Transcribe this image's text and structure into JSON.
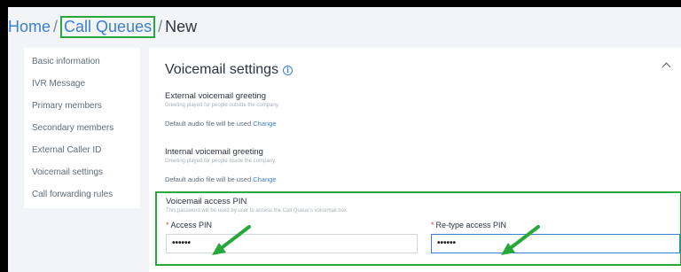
{
  "breadcrumb": {
    "home": "Home",
    "sep1": "/",
    "queues": "Call Queues",
    "sep2": "/",
    "current": "New"
  },
  "sidebar": {
    "items": [
      {
        "label": "Basic information"
      },
      {
        "label": "IVR Message"
      },
      {
        "label": "Primary members"
      },
      {
        "label": "Secondary members"
      },
      {
        "label": "External Caller ID"
      },
      {
        "label": "Voicemail settings"
      },
      {
        "label": "Call forwarding rules"
      }
    ]
  },
  "section": {
    "title": "Voicemail settings",
    "external": {
      "label": "External voicemail greeting",
      "hint": "Greeting played for people outside the company.",
      "default_text": "Default audio file will be used",
      "change": "Change"
    },
    "internal": {
      "label": "Internal voicemail greeting",
      "hint": "Greeting played for people inside the company.",
      "default_text": "Default audio file will be used",
      "change": "Change"
    },
    "pin": {
      "label": "Voicemail access PIN",
      "hint": "This password will be used by user to access the Call Queue's voicemail box.",
      "required_mark": "*",
      "access_label": "Access PIN",
      "access_value": "••••••",
      "retype_label": "Re-type access PIN",
      "retype_value": "••••••"
    }
  },
  "colors": {
    "accent": "#3a7fd0",
    "highlight": "#27a83a",
    "required": "#e0533d"
  },
  "icons": {
    "info": "info-icon",
    "collapse": "chevron-up-icon",
    "annotation": "arrow-icon"
  }
}
